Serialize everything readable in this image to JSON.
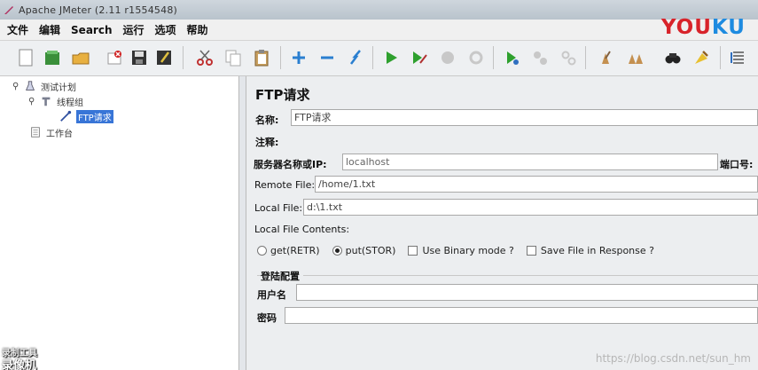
{
  "window": {
    "title": "Apache JMeter (2.11 r1554548)"
  },
  "menu": {
    "items": [
      "文件",
      "编辑",
      "Search",
      "运行",
      "选项",
      "帮助"
    ]
  },
  "toolbar": {
    "buttons": [
      "new-icon",
      "templates-icon",
      "open-icon",
      "close-icon",
      "save-icon",
      "save-as-icon",
      "cut-icon",
      "copy-icon",
      "paste-icon",
      "expand-icon",
      "collapse-icon",
      "toggle-icon",
      "start-icon",
      "start-no-pause-icon",
      "stop-icon",
      "shutdown-icon",
      "remote-start-icon",
      "remote-stop-icon",
      "remote-shutdown-icon",
      "clear-icon",
      "clear-all-icon",
      "search-icon",
      "reset-search-icon",
      "function-helper-icon"
    ]
  },
  "watermark": {
    "logo_you": "YOU",
    "logo_ku": "KU",
    "bottom_left_line1": "录制工具",
    "bottom_left_line2": "录像机",
    "bottom_right": "https://blog.csdn.net/sun_hm"
  },
  "tree": {
    "items": [
      {
        "label": "测试计划",
        "icon": "test-plan-icon",
        "toggle": "⚲"
      },
      {
        "label": "线程组",
        "icon": "thread-group-icon",
        "toggle": "⚲"
      },
      {
        "label": "FTP请求",
        "icon": "ftp-sampler-icon",
        "toggle": ""
      },
      {
        "label": "工作台",
        "icon": "workbench-icon",
        "toggle": ""
      }
    ]
  },
  "form": {
    "heading": "FTP请求",
    "name_label": "名称:",
    "name_value": "FTP请求",
    "comment_label": "注释:",
    "server_label": "服务器名称或IP:",
    "server_value": "localhost",
    "port_label": "端口号:",
    "remote_file_label": "Remote File:",
    "remote_file_value": "/home/1.txt",
    "local_file_label": "Local File:",
    "local_file_value": "d:\\1.txt",
    "local_contents_label": "Local File Contents:",
    "radio_get": "get(RETR)",
    "radio_put": "put(STOR)",
    "selected_mode": "put(STOR)",
    "check_binary": "Use Binary mode ?",
    "check_save": "Save File in Response ?",
    "login_section": "登陆配置",
    "username_label": "用户名",
    "password_label": "密码"
  }
}
